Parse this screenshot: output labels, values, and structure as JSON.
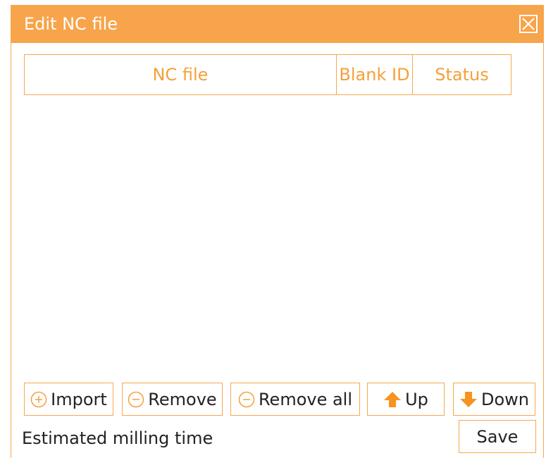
{
  "dialog": {
    "title": "Edit NC file",
    "close_icon": "close-box-icon",
    "accent_color": "#f8a44a"
  },
  "table": {
    "columns": [
      "NC file",
      "Blank ID",
      "Status"
    ],
    "rows": []
  },
  "toolbar": {
    "import": {
      "label": "Import",
      "icon": "plus-circle-icon"
    },
    "remove": {
      "label": "Remove",
      "icon": "minus-circle-icon"
    },
    "remove_all": {
      "label": "Remove all",
      "icon": "minus-circle-icon"
    },
    "up": {
      "label": "Up",
      "icon": "arrow-up-icon"
    },
    "down": {
      "label": "Down",
      "icon": "arrow-down-icon"
    }
  },
  "footer": {
    "milling_time_label": "Estimated milling time",
    "save_label": "Save"
  }
}
